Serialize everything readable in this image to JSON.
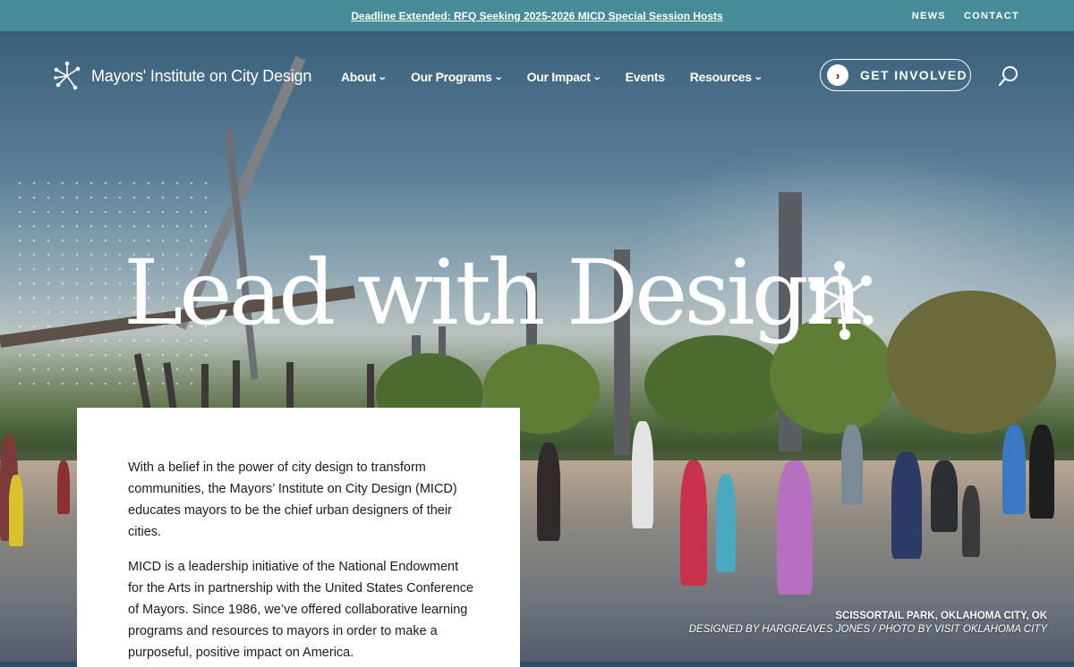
{
  "announcement": {
    "text": "Deadline Extended: RFQ Seeking 2025-2026 MICD Special Session Hosts"
  },
  "utility_nav": [
    "NEWS",
    "CONTACT"
  ],
  "logo": {
    "text": "Mayors' Institute on City Design",
    "icon": "spark-icon"
  },
  "main_nav": [
    {
      "label": "About",
      "dropdown": true
    },
    {
      "label": "Our Programs",
      "dropdown": true
    },
    {
      "label": "Our Impact",
      "dropdown": true
    },
    {
      "label": "Events",
      "dropdown": false
    },
    {
      "label": "Resources",
      "dropdown": true
    }
  ],
  "cta": {
    "label": "GET INVOLVED",
    "icon": "chevron-right-icon"
  },
  "search": {
    "icon": "search-icon"
  },
  "hero": {
    "headline": "Lead with Design",
    "caption_line1": "SCISSORTAIL PARK, OKLAHOMA CITY, OK",
    "caption_line2": "DESIGNED BY HARGREAVES JONES / PHOTO BY VISIT OKLAHOMA CITY"
  },
  "intro": {
    "p1": "With a belief in the power of city design to transform communities, the Mayors’ Institute on City Design (MICD) educates mayors to be the chief urban designers of their cities.",
    "p2": "MICD is a leadership initiative of the National Endowment for the Arts in partnership with the United States Conference of Mayors. Since 1986, we’ve offered collaborative learning programs and resources to mayors in order to make a purposeful, positive impact on America."
  },
  "colors": {
    "topbar": "#478b97",
    "text_dark": "#1b1b1b",
    "white": "#ffffff"
  }
}
